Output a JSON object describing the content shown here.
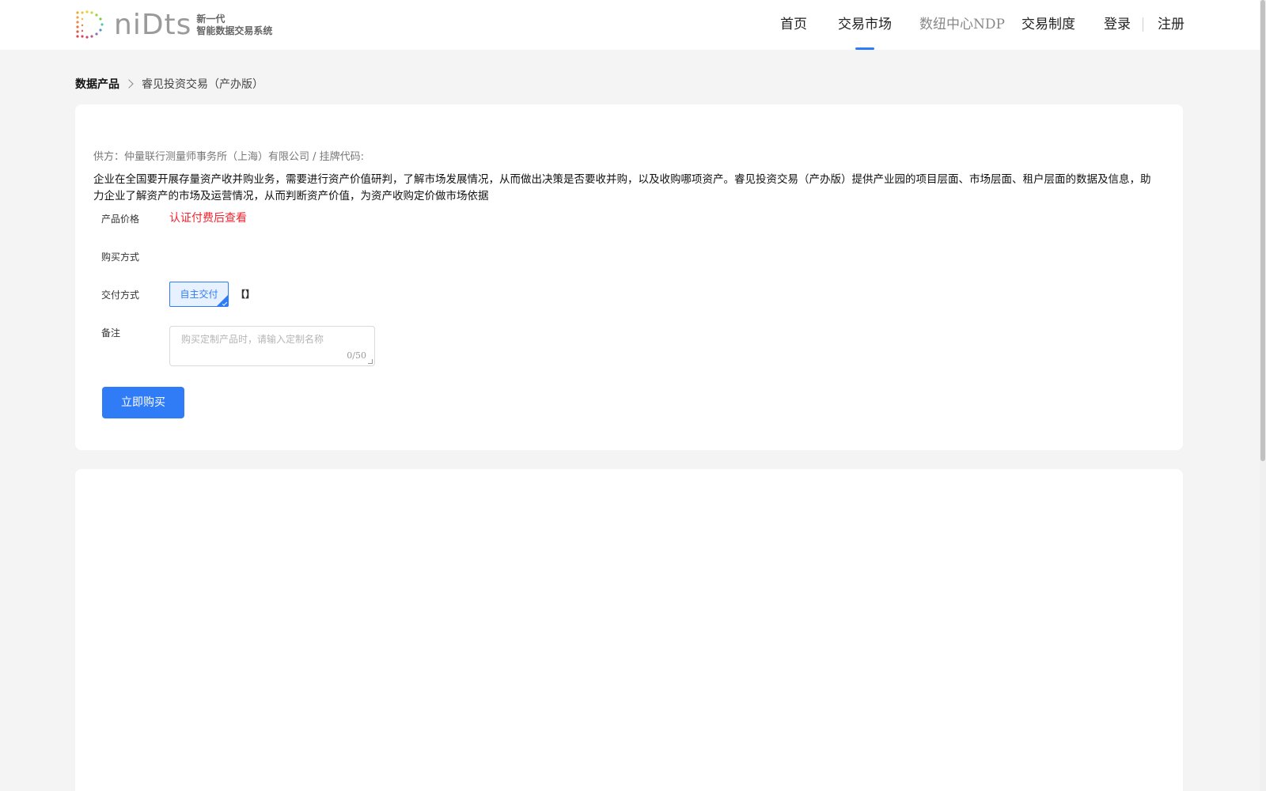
{
  "header": {
    "logo_word": "niDts",
    "logo_line1": "新一代",
    "logo_line2": "智能数据交易系统",
    "nav": [
      {
        "label": "首页"
      },
      {
        "label": "交易市场"
      },
      {
        "label": "数纽中心NDP"
      },
      {
        "label": "交易制度"
      },
      {
        "label": "登录"
      },
      {
        "label": "注册"
      }
    ],
    "active_nav": "交易市场"
  },
  "breadcrumb": {
    "root": "数据产品",
    "current": "睿见投资交易（产办版）"
  },
  "product": {
    "supplier_line": "供方：仲量联行测量师事务所（上海）有限公司 / 挂牌代码:",
    "description": "企业在全国要开展存量资产收并购业务，需要进行资产价值研判，了解市场发展情况，从而做出决策是否要收并购，以及收购哪项资产。睿见投资交易（产办版）提供产业园的项目层面、市场层面、租户层面的数据及信息，助力企业了解资产的市场及运营情况，从而判断资产价值，为资产收购定价做市场依据",
    "price_label": "产品价格",
    "price_value": "认证付费后查看",
    "purchase_label": "购买方式",
    "delivery_label": "交付方式",
    "delivery_option": "自主交付",
    "delivery_extra": "【】",
    "remark_label": "备注",
    "remark_placeholder": "购买定制产品时，请输入定制名称",
    "remark_count": "0/50",
    "buy_button": "立即购买"
  },
  "colors": {
    "accent": "#2f7cf6",
    "price": "#f5222d",
    "background": "#f4f4f4"
  }
}
